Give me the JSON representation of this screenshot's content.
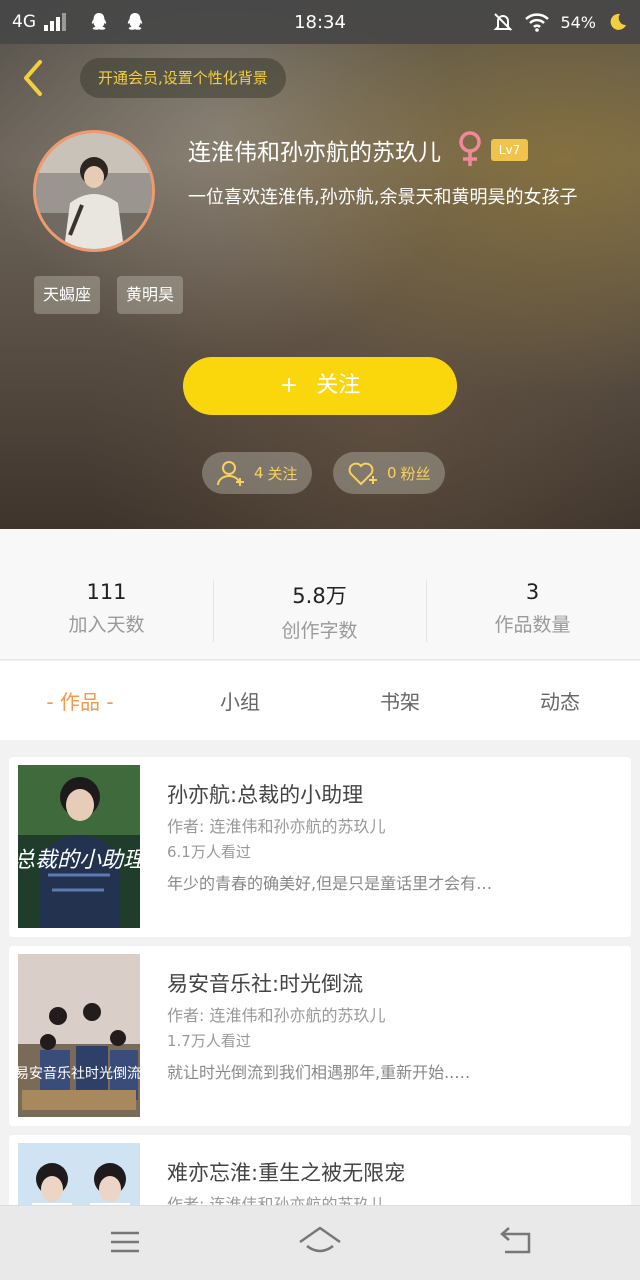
{
  "status_bar": {
    "network": "4G",
    "time": "18:34",
    "battery": "54%",
    "icons": [
      "signal-icon",
      "qq-icon",
      "qq-icon",
      "mute-icon",
      "wifi-icon",
      "moon-icon"
    ]
  },
  "header": {
    "vip_prompt": "开通会员,设置个性化背景",
    "username": "连淮伟和孙亦航的苏玖儿",
    "level": "Lv7",
    "bio": "一位喜欢连淮伟,孙亦航,余景天和黄明昊的女孩子",
    "tags": [
      "天蝎座",
      "黄明昊"
    ],
    "follow_label": "关注",
    "follow_plus": "+",
    "following_count": "4",
    "following_label": "关注",
    "fans_count": "0",
    "fans_label": "粉丝",
    "colors": {
      "accent": "#fad70d",
      "vip_text": "#f3cf3e",
      "avatar_ring": "#f19a6b"
    }
  },
  "stats": [
    {
      "value": "111",
      "label": "加入天数"
    },
    {
      "value": "5.8万",
      "label": "创作字数"
    },
    {
      "value": "3",
      "label": "作品数量"
    }
  ],
  "tabs": [
    {
      "label": "- 作品 -",
      "active": true
    },
    {
      "label": "小组",
      "active": false
    },
    {
      "label": "书架",
      "active": false
    },
    {
      "label": "动态",
      "active": false
    }
  ],
  "books": [
    {
      "title": "孙亦航:总裁的小助理",
      "author": "作者: 连淮伟和孙亦航的苏玖儿",
      "views": "6.1万人看过",
      "desc": "年少的青春的确美好,但是只是童话里才会有…",
      "cover_text": "总裁的小助理"
    },
    {
      "title": "易安音乐社:时光倒流",
      "author": "作者: 连淮伟和孙亦航的苏玖儿",
      "views": "1.7万人看过",
      "desc": "就让时光倒流到我们相遇那年,重新开始..…",
      "cover_text": "易安音乐社时光倒流"
    },
    {
      "title": "难亦忘淮:重生之被无限宠",
      "author": "作者: 连淮伟和孙亦航的苏玖儿",
      "views": "",
      "desc": "",
      "cover_text": ""
    }
  ],
  "nav": [
    "menu-icon",
    "home-icon",
    "back-icon"
  ]
}
